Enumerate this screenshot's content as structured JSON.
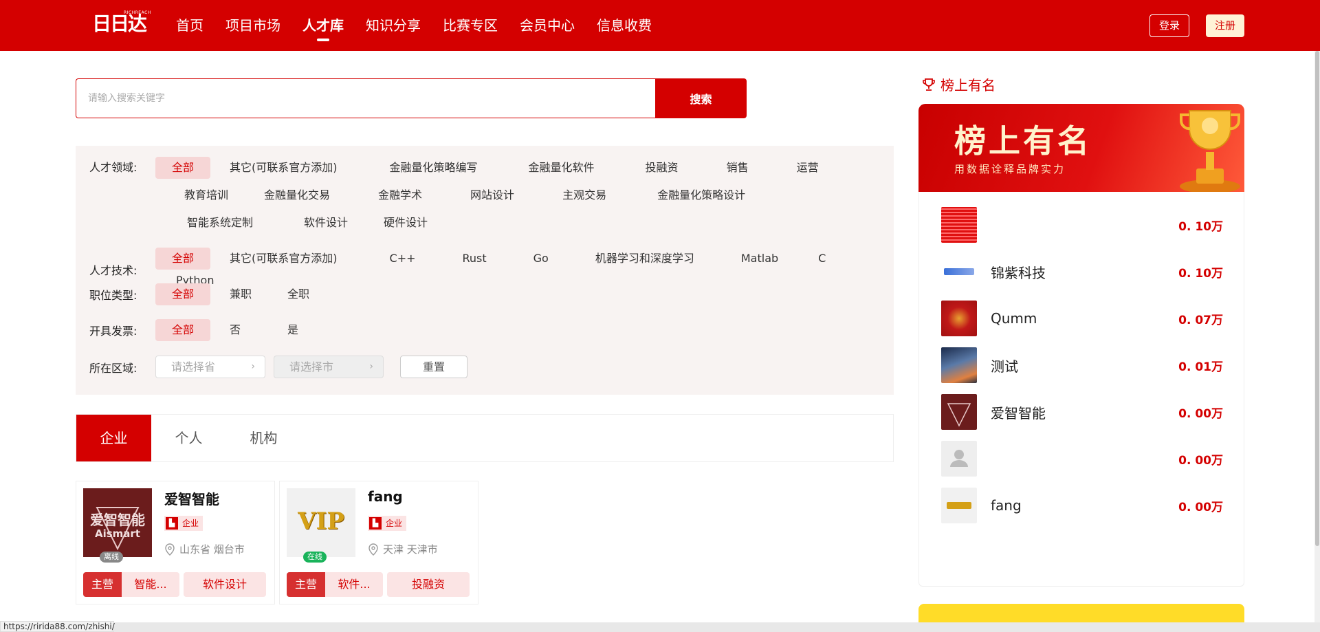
{
  "header": {
    "logo_text": "日日达",
    "logo_sub": "RICHREACH",
    "nav": [
      "首页",
      "项目市场",
      "人才库",
      "知识分享",
      "比赛专区",
      "会员中心",
      "信息收费"
    ],
    "login": "登录",
    "register": "注册"
  },
  "search": {
    "placeholder": "请输入搜索关键字",
    "button": "搜索"
  },
  "filters": {
    "field_label": "人才领域:",
    "field_options": [
      "全部",
      "其它(可联系官方添加)",
      "金融量化策略编写",
      "金融量化软件",
      "投融资",
      "销售",
      "运营",
      "教育培训",
      "金融量化交易",
      "金融学术",
      "网站设计",
      "主观交易",
      "金融量化策略设计",
      "智能系统定制",
      "软件设计",
      "硬件设计"
    ],
    "tech_label": "人才技术:",
    "tech_options": [
      "全部",
      "其它(可联系官方添加)",
      "C++",
      "Rust",
      "Go",
      "机器学习和深度学习",
      "Matlab",
      "C",
      "Python"
    ],
    "job_label": "职位类型:",
    "job_options": [
      "全部",
      "兼职",
      "全职"
    ],
    "invoice_label": "开具发票:",
    "invoice_options": [
      "全部",
      "否",
      "是"
    ],
    "region_label": "所在区域:",
    "province_placeholder": "请选择省",
    "city_placeholder": "请选择市",
    "reset": "重置"
  },
  "tabs": [
    "企业",
    "个人",
    "机构"
  ],
  "cards": [
    {
      "name": "爱智智能",
      "type": "企业",
      "status": "离线",
      "location": "山东省 烟台市",
      "tag_main": "主营",
      "tag1": "智能...",
      "tag2": "软件设计",
      "avatar_text": "爱智智能",
      "avatar_sub": "Aismart"
    },
    {
      "name": "fang",
      "type": "企业",
      "status": "在线",
      "location": "天津 天津市",
      "tag_main": "主营",
      "tag1": "软件...",
      "tag2": "投融资",
      "avatar_text": "VIP"
    }
  ],
  "ranking": {
    "title": "榜上有名",
    "banner_title": "榜上有名",
    "banner_sub": "用数据诠释品牌实力",
    "items": [
      {
        "name": "",
        "value": "0. 10万"
      },
      {
        "name": "锦紫科技",
        "value": "0. 10万"
      },
      {
        "name": "Qumm",
        "value": "0. 07万"
      },
      {
        "name": "测试",
        "value": "0. 01万"
      },
      {
        "name": "爱智智能",
        "value": "0. 00万"
      },
      {
        "name": "",
        "value": "0. 00万"
      },
      {
        "name": "fang",
        "value": "0. 00万"
      }
    ]
  },
  "statusbar": {
    "url": "https://ririda88.com/zhishi/"
  },
  "colors": {
    "brand_red": "#d40000",
    "light_red": "#fbe4e4",
    "online_green": "#19b35a",
    "offline_gray": "#888888"
  }
}
